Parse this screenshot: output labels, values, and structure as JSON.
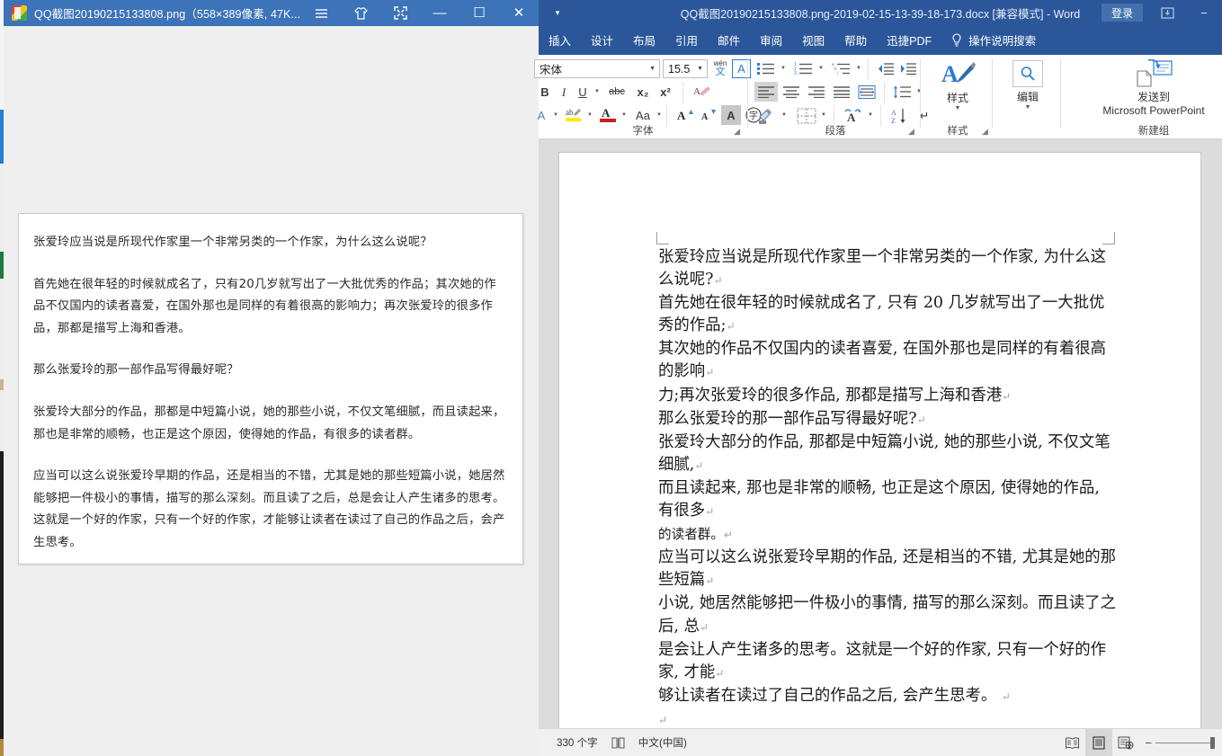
{
  "viewer": {
    "title": "QQ截图20190215133808.png（558×389像素, 47K...",
    "buttons": {
      "menu": "menu-icon",
      "skin": "skin-icon",
      "fullscreen": "fullscreen-icon",
      "minimize": "—",
      "maximize": "☐",
      "close": "✕"
    },
    "image_paragraphs": [
      "张爱玲应当说是所现代作家里一个非常另类的一个作家，为什么这么说呢？",
      "首先她在很年轻的时候就成名了，只有20几岁就写出了一大批优秀的作品；其次她的作品不仅国内的读者喜爱，在国外那也是同样的有着很高的影响力；再次张爱玲的很多作品，那都是描写上海和香港。",
      "那么张爱玲的那一部作品写得最好呢？",
      "张爱玲大部分的作品，那都是中短篇小说，她的那些小说，不仅文笔细腻，而且读起来，那也是非常的顺畅，也正是这个原因，使得她的作品，有很多的读者群。",
      "应当可以这么说张爱玲早期的作品，还是相当的不错，尤其是她的那些短篇小说，她居然能够把一件极小的事情，描写的那么深刻。而且读了之后，总是会让人产生诸多的思考。这就是一个好的作家，只有一个好的作家，才能够让读者在读过了自己的作品之后，会产生思考。"
    ]
  },
  "word": {
    "title": "QQ截图20190215133808.png-2019-02-15-13-39-18-173.docx [兼容模式]  -  Word",
    "signin_label": "登录",
    "qat_more": "▾",
    "minimize_label": "−",
    "tabs": [
      "插入",
      "设计",
      "布局",
      "引用",
      "邮件",
      "审阅",
      "视图",
      "帮助",
      "迅捷PDF"
    ],
    "tellme_placeholder": "操作说明搜索",
    "font": {
      "name": "宋体",
      "size": "15.5",
      "group_label": "字体",
      "buttons": {
        "phonetic": "wén",
        "char_border": "A",
        "italic": "I",
        "underline": "U",
        "strikethrough": "abc",
        "subscript": "x₂",
        "superscript": "x²",
        "clear_format": "clear-formatting-icon",
        "text_highlight": "ab",
        "font_color": "A",
        "change_case": "Aa",
        "grow_font": "A",
        "shrink_font": "A",
        "text_effects": "A",
        "enclose_char": "字"
      }
    },
    "paragraph": {
      "group_label": "段落",
      "buttons": {
        "bullets": "bullet-list-icon",
        "numbering": "numbered-list-icon",
        "multilevel": "multilevel-list-icon",
        "decrease_indent": "decrease-indent-icon",
        "increase_indent": "increase-indent-icon",
        "align_left": "align-left-icon",
        "align_center": "align-center-icon",
        "align_right": "align-right-icon",
        "justify": "justify-icon",
        "distribute": "distribute-icon",
        "line_spacing": "line-spacing-icon",
        "shading": "shading-icon",
        "borders": "borders-icon",
        "asian_layout": "asian-layout-icon",
        "sort": "sort-icon",
        "show_marks": "show-formatting-marks-icon"
      }
    },
    "styles": {
      "group_label": "样式",
      "button_label": "样式"
    },
    "editing": {
      "group_label": "",
      "button_label": "编辑"
    },
    "newgroup": {
      "group_label": "新建组",
      "button_line1": "发送到",
      "button_line2": "Microsoft PowerPoint"
    },
    "document_lines": [
      {
        "text": "张爱玲应当说是所现代作家里一个非常另类的一个作家, 为什么这么说呢?",
        "alt": false
      },
      {
        "text": "首先她在很年轻的时候就成名了, 只有 20 几岁就写出了一大批优秀的作品;",
        "alt": false
      },
      {
        "text": "其次她的作品不仅国内的读者喜爱, 在国外那也是同样的有着很高的影响",
        "alt": false
      },
      {
        "text": "力;再次张爱玲的很多作品, 那都是描写上海和香港",
        "alt": false
      },
      {
        "text": "那么张爱玲的那一部作品写得最好呢?",
        "alt": false
      },
      {
        "text": "张爱玲大部分的作品, 那都是中短篇小说, 她的那些小说, 不仅文笔细腻,",
        "alt": false
      },
      {
        "text": "而且读起来, 那也是非常的顺畅, 也正是这个原因, 使得她的作品, 有很多",
        "alt": false
      },
      {
        "text": "的读者群。",
        "alt": true
      },
      {
        "text": "应当可以这么说张爱玲早期的作品, 还是相当的不错, 尤其是她的那些短篇",
        "alt": false
      },
      {
        "text": "小说, 她居然能够把一件极小的事情, 描写的那么深刻。而且读了之后, 总",
        "alt": false
      },
      {
        "text": "是会让人产生诸多的思考。这就是一个好的作家, 只有一个好的作家, 才能",
        "alt": false
      },
      {
        "text": "够让读者在读过了自己的作品之后, 会产生思考。 ",
        "alt": false
      },
      {
        "text": " ",
        "alt": false
      }
    ],
    "status": {
      "word_count": "330 个字",
      "proofing": "proofing-icon",
      "language": "中文(中国)",
      "view_read": "read-mode-icon",
      "view_print": "print-layout-icon",
      "view_web": "web-layout-icon",
      "zoom_minus": "−"
    }
  },
  "colors": {
    "word_blue": "#2b579a",
    "viewer_blue": "#3c73b9",
    "accent": "#2b579a",
    "doc_bg": "#dcdcdc"
  }
}
